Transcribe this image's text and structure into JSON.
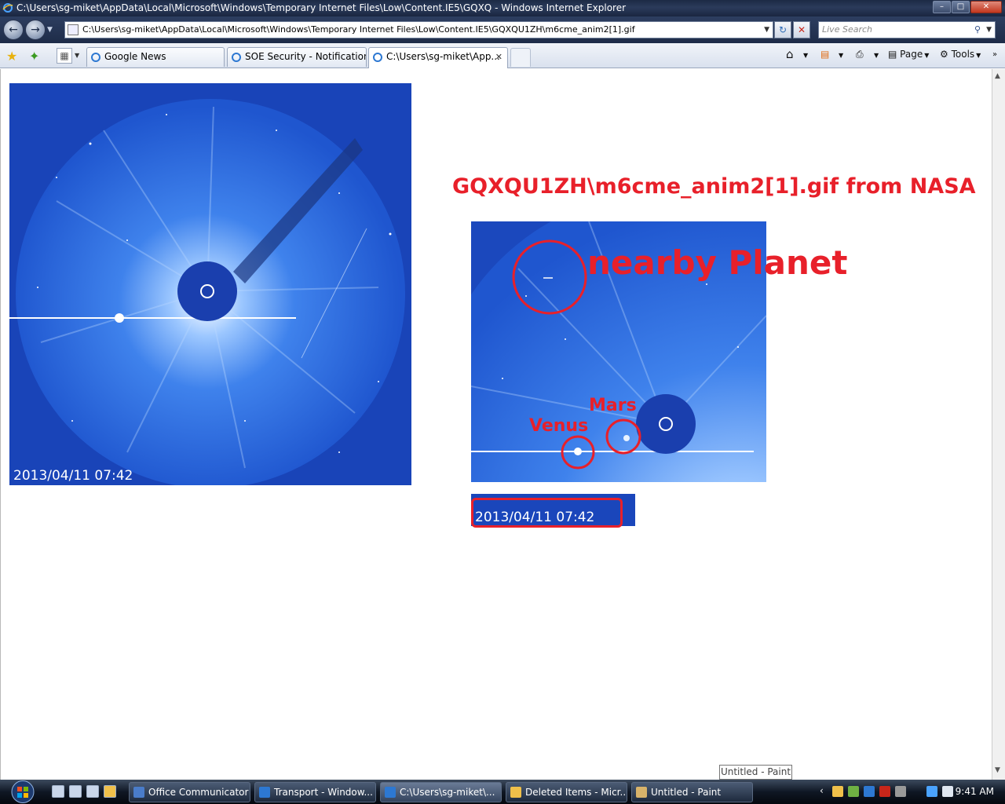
{
  "window": {
    "title": "C:\\Users\\sg-miket\\AppData\\Local\\Microsoft\\Windows\\Temporary Internet Files\\Low\\Content.IE5\\GQXQ - Windows Internet Explorer"
  },
  "address_bar": {
    "url": "C:\\Users\\sg-miket\\AppData\\Local\\Microsoft\\Windows\\Temporary Internet Files\\Low\\Content.IE5\\GQXQU1ZH\\m6cme_anim2[1].gif"
  },
  "search": {
    "placeholder": "Live Search"
  },
  "tabs": [
    {
      "label": "Google News"
    },
    {
      "label": "SOE Security - Notification"
    },
    {
      "label": "C:\\Users\\sg-miket\\App..."
    }
  ],
  "command_bar": {
    "page_label": "Page",
    "tools_label": "Tools"
  },
  "page": {
    "left_image_timestamp": "2013/04/11 07:42",
    "heading": "GQXQU1ZH\\m6cme_anim2[1].gif from NASA",
    "annotation_planet": "nearby Planet",
    "annotation_mars": "Mars",
    "annotation_venus": "Venus",
    "cropped_timestamp": "2013/04/11 07:42"
  },
  "tooltip": "Untitled - Paint",
  "taskbar": {
    "buttons": [
      {
        "label": "Office Communicator"
      },
      {
        "label": "Transport - Window..."
      },
      {
        "label": "C:\\Users\\sg-miket\\..."
      },
      {
        "label": "Deleted Items - Micr..."
      },
      {
        "label": "Untitled - Paint"
      }
    ],
    "clock": "9:41 AM"
  },
  "colors": {
    "annotation_red": "#e8202a",
    "lasco_blue": "#1944b8",
    "titlebar": "#1c2a45"
  }
}
